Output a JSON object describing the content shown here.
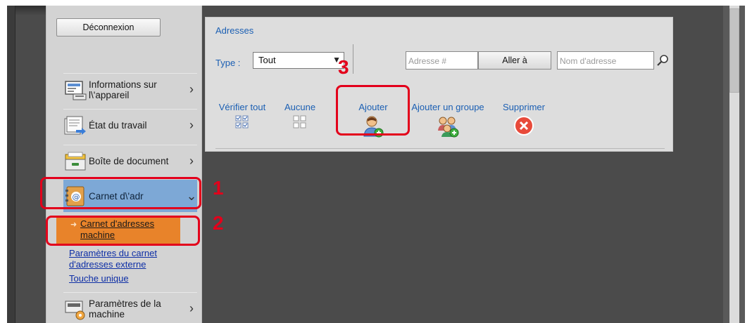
{
  "sidebar": {
    "logout_label": "Déconnexion",
    "items": [
      {
        "label_line1": "Informations sur",
        "label_line2": "l\\'appareil",
        "icon": "device-info-icon"
      },
      {
        "label_line1": "État du travail",
        "label_line2": "",
        "icon": "job-status-icon"
      },
      {
        "label_line1": "Boîte de document",
        "label_line2": "",
        "icon": "document-box-icon"
      },
      {
        "label_line1": "Carnet d\\'adr",
        "label_line2": "",
        "icon": "address-book-icon"
      },
      {
        "label_line1": "Paramètres de la",
        "label_line2": "machine",
        "icon": "machine-settings-icon"
      }
    ],
    "submenu": {
      "selected_line1": "Carnet d'adresses",
      "selected_line2": "machine",
      "link1_line1": "Paramètres du carnet",
      "link1_line2": "d'adresses externe",
      "link2": "Touche unique"
    }
  },
  "panel": {
    "title": "Adresses",
    "type_label": "Type :",
    "type_value": "Tout",
    "address_number_placeholder": "Adresse #",
    "goto_label": "Aller à",
    "address_name_placeholder": "Nom d'adresse"
  },
  "actions": [
    {
      "label": "Vérifier tout",
      "icon": "check-all-icon"
    },
    {
      "label": "Aucune",
      "icon": "none-icon"
    },
    {
      "label": "Ajouter",
      "icon": "add-user-icon"
    },
    {
      "label": "Ajouter un groupe",
      "icon": "add-group-icon"
    },
    {
      "label": "Supprimer",
      "icon": "delete-icon"
    }
  ],
  "callouts": {
    "one": "1",
    "two": "2",
    "three": "3"
  },
  "colors": {
    "accent_blue": "#1b5fb3",
    "callout_red": "#e3001b",
    "selected_orange": "#e8832a",
    "active_nav": "#7da8d6"
  }
}
